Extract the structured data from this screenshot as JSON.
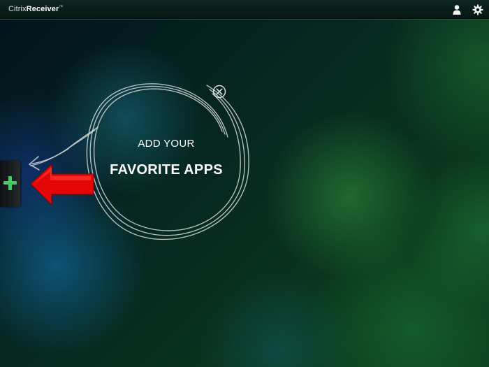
{
  "app": {
    "brand_prefix": "Citrix",
    "brand_name": "Receiver",
    "trademark": "™"
  },
  "header": {
    "icons": [
      "user-icon",
      "gear-icon"
    ]
  },
  "add_panel": {
    "icon": "plus-icon",
    "accent_color": "#49c86a"
  },
  "hint": {
    "line1": "ADD YOUR",
    "line2": "FAVORITE APPS",
    "close_icon": "close-circle-icon",
    "arrow_color": "#e00000"
  }
}
